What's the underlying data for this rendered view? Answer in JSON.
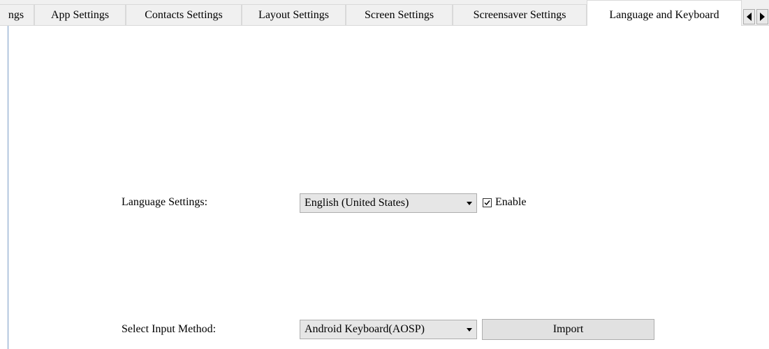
{
  "tabs": [
    {
      "label": "ngs",
      "active": false
    },
    {
      "label": "App Settings",
      "active": false
    },
    {
      "label": "Contacts Settings",
      "active": false
    },
    {
      "label": "Layout Settings",
      "active": false
    },
    {
      "label": "Screen Settings",
      "active": false
    },
    {
      "label": "Screensaver Settings",
      "active": false
    },
    {
      "label": "Language and Keyboard",
      "active": true
    }
  ],
  "scroll_buttons": {
    "left_icon": "triangle-left-icon",
    "right_icon": "triangle-right-icon"
  },
  "language": {
    "label": "Language Settings:",
    "selected": "English (United States)",
    "enable_label": "Enable",
    "enable_checked": true
  },
  "input_method": {
    "label": "Select Input Method:",
    "selected": "Android Keyboard(AOSP)",
    "import_label": "Import"
  },
  "colors": {
    "tab_background": "#f0f0f0",
    "active_tab_background": "#ffffff",
    "combo_background": "#e6e6e6",
    "button_background": "#e1e1e1",
    "panel_edge": "#7a9cc6"
  }
}
